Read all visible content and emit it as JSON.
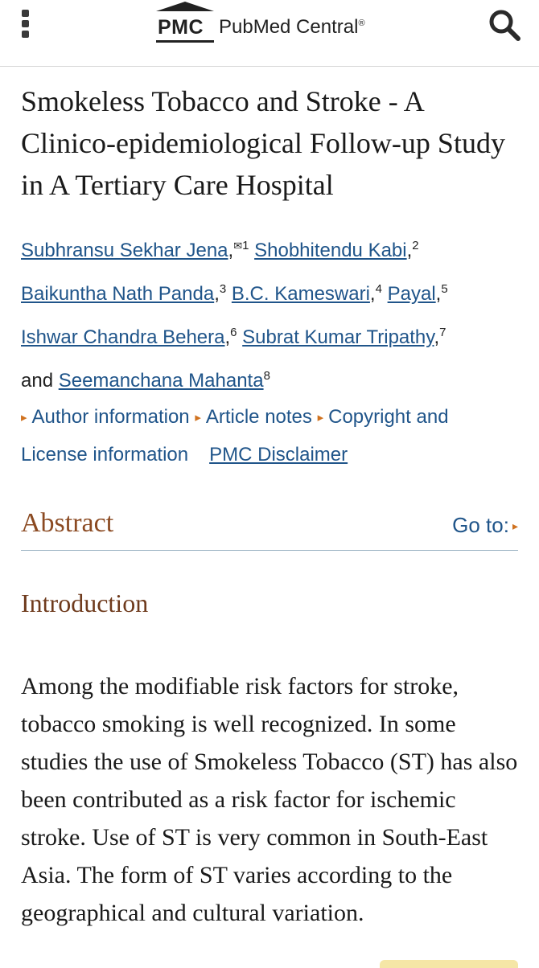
{
  "header": {
    "logo_abbrev": "PMC",
    "logo_name": "PubMed Central",
    "logo_mark": "®"
  },
  "article": {
    "title": "Smokeless Tobacco and Stroke - A Clinico-epidemiological Follow-up Study in A Tertiary Care Hospital",
    "authors": [
      {
        "name": "Subhransu Sekhar Jena",
        "sup": "1",
        "email": true
      },
      {
        "name": "Shobhitendu Kabi",
        "sup": "2"
      },
      {
        "name": "Baikuntha Nath Panda",
        "sup": "3"
      },
      {
        "name": "B.C. Kameswari",
        "sup": "4"
      },
      {
        "name": "Payal",
        "sup": "5"
      },
      {
        "name": "Ishwar Chandra Behera",
        "sup": "6"
      },
      {
        "name": "Subrat Kumar Tripathy",
        "sup": "7"
      },
      {
        "name": "Seemanchana Mahanta",
        "sup": "8"
      }
    ],
    "and_text": "and"
  },
  "info_links": {
    "author_information": "Author information",
    "article_notes": "Article notes",
    "copyright_line1": "Copyright and",
    "copyright_line2": "License information",
    "disclaimer": "PMC Disclaimer"
  },
  "abstract": {
    "heading": "Abstract",
    "goto": "Go to:",
    "section_title": "Introduction",
    "text": "Among the modifiable risk factors for stroke, tobacco smoking is well recognized. In some studies the use of Smokeless Tobacco (ST) has also been contributed as a risk factor for ischemic stroke. Use of ST is very common in South-East Asia. The form of ST varies according to the geographical and cultural variation."
  },
  "colors": {
    "link": "#20558a",
    "heading_brown": "#8b4a22",
    "triangle_orange": "#d0721f"
  },
  "icons": {
    "menu": "kebab-menu-icon",
    "search": "search-icon",
    "email": "envelope-icon"
  }
}
